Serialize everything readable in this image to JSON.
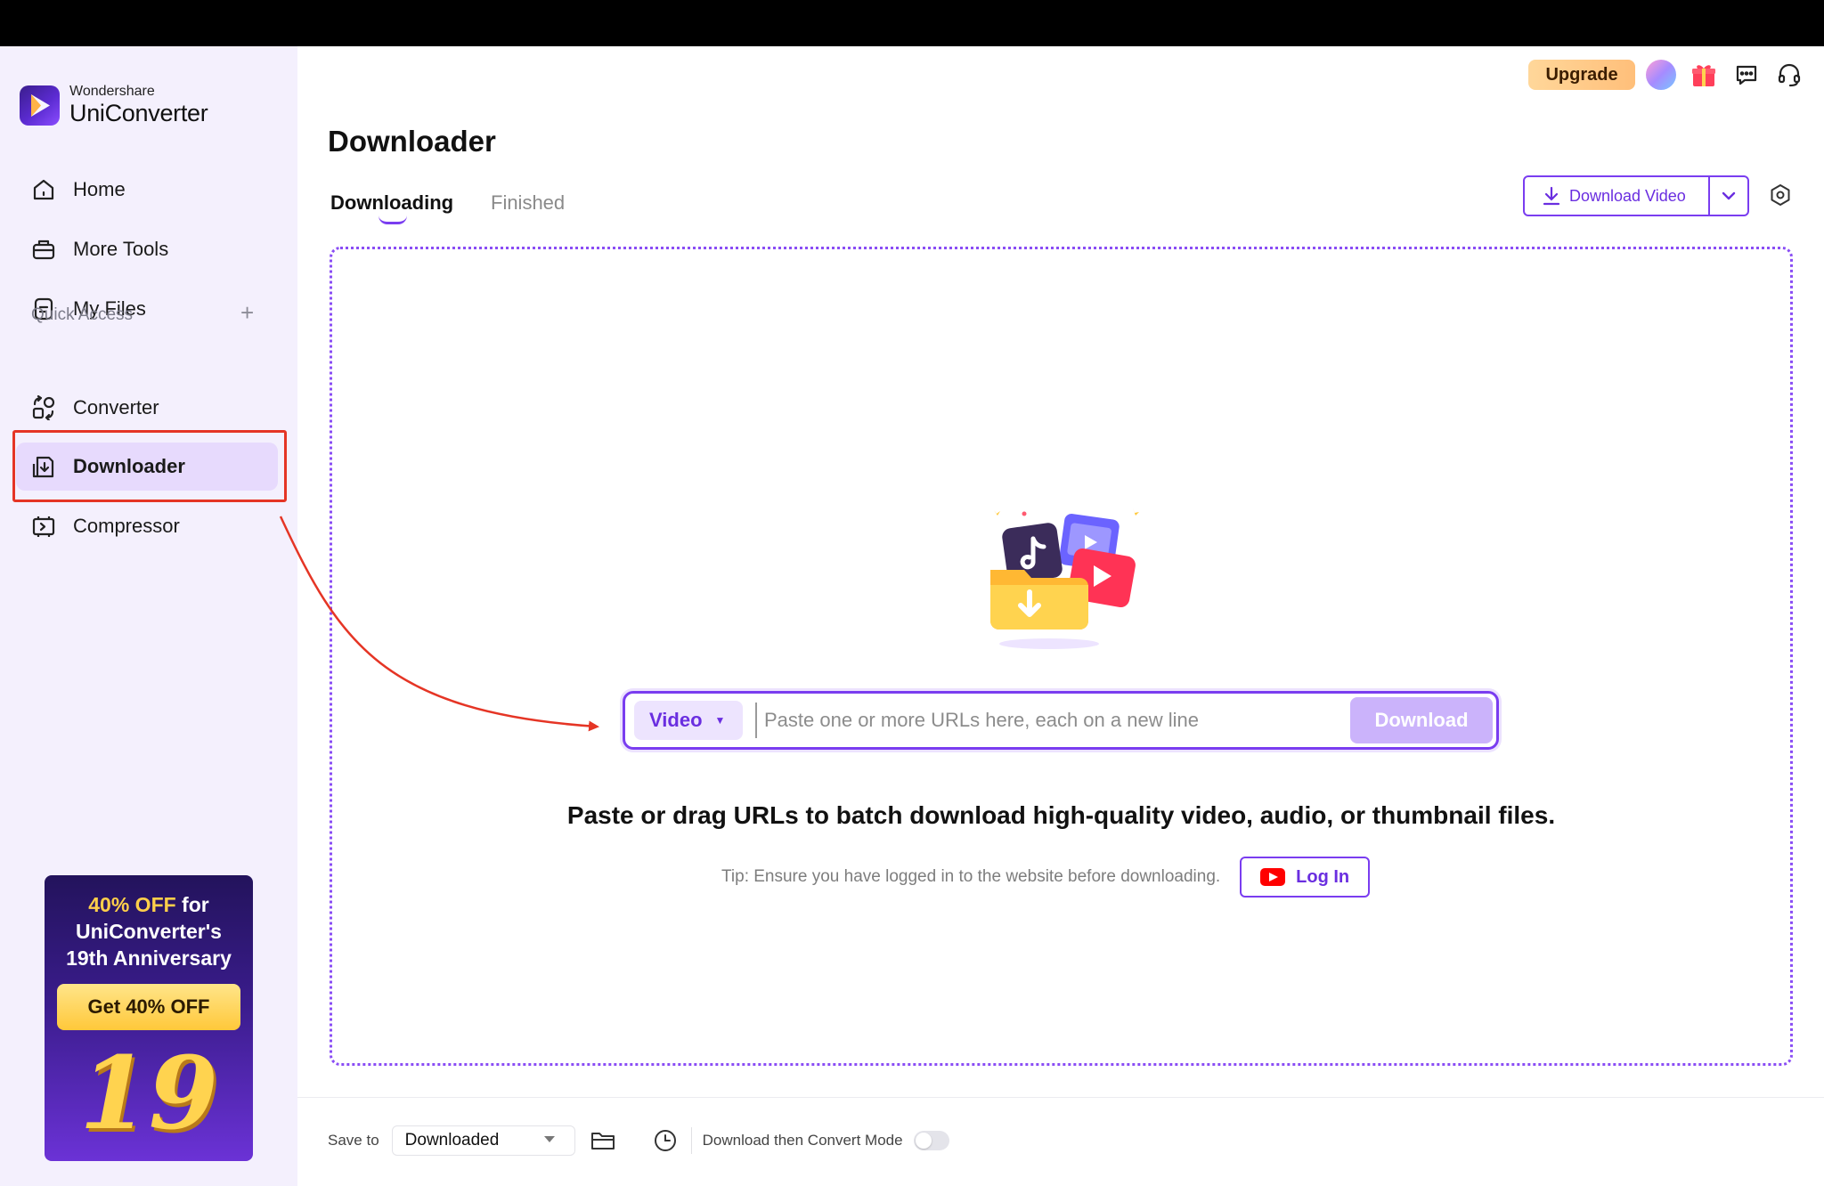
{
  "app": {
    "brand_top": "Wondershare",
    "brand_name": "UniConverter",
    "accent_color": "#7a3df0"
  },
  "sidebar": {
    "items": [
      {
        "label": "Home",
        "icon": "home-icon"
      },
      {
        "label": "More Tools",
        "icon": "toolbox-icon"
      },
      {
        "label": "My Files",
        "icon": "file-icon"
      }
    ],
    "quick_access_title": "Quick Access",
    "quick_access_items": [
      {
        "label": "Converter",
        "icon": "converter-icon"
      },
      {
        "label": "Downloader",
        "icon": "downloader-icon",
        "active": true
      },
      {
        "label": "Compressor",
        "icon": "compressor-icon"
      }
    ]
  },
  "promo": {
    "line1_highlight": "40% OFF",
    "line1_rest": " for",
    "line2": "UniConverter's",
    "line3": "19th Anniversary",
    "button": "Get 40% OFF",
    "number": "19"
  },
  "header": {
    "upgrade_label": "Upgrade",
    "icons": [
      "avatar",
      "gift-icon",
      "chat-icon",
      "headset-icon"
    ]
  },
  "page": {
    "title": "Downloader",
    "tabs": [
      {
        "label": "Downloading",
        "active": true
      },
      {
        "label": "Finished",
        "active": false
      }
    ],
    "download_video_label": "Download Video"
  },
  "dropzone": {
    "type_selected": "Video",
    "url_placeholder": "Paste one or more URLs here, each on a new line",
    "download_label": "Download",
    "headline": "Paste or drag URLs to batch download high-quality video, audio, or thumbnail files.",
    "tip": "Tip: Ensure you have logged in to the website before downloading.",
    "login_label": "Log In"
  },
  "bottom": {
    "save_to_label": "Save to",
    "save_to_value": "Downloaded",
    "mode_label": "Download then Convert Mode",
    "mode_enabled": false
  }
}
